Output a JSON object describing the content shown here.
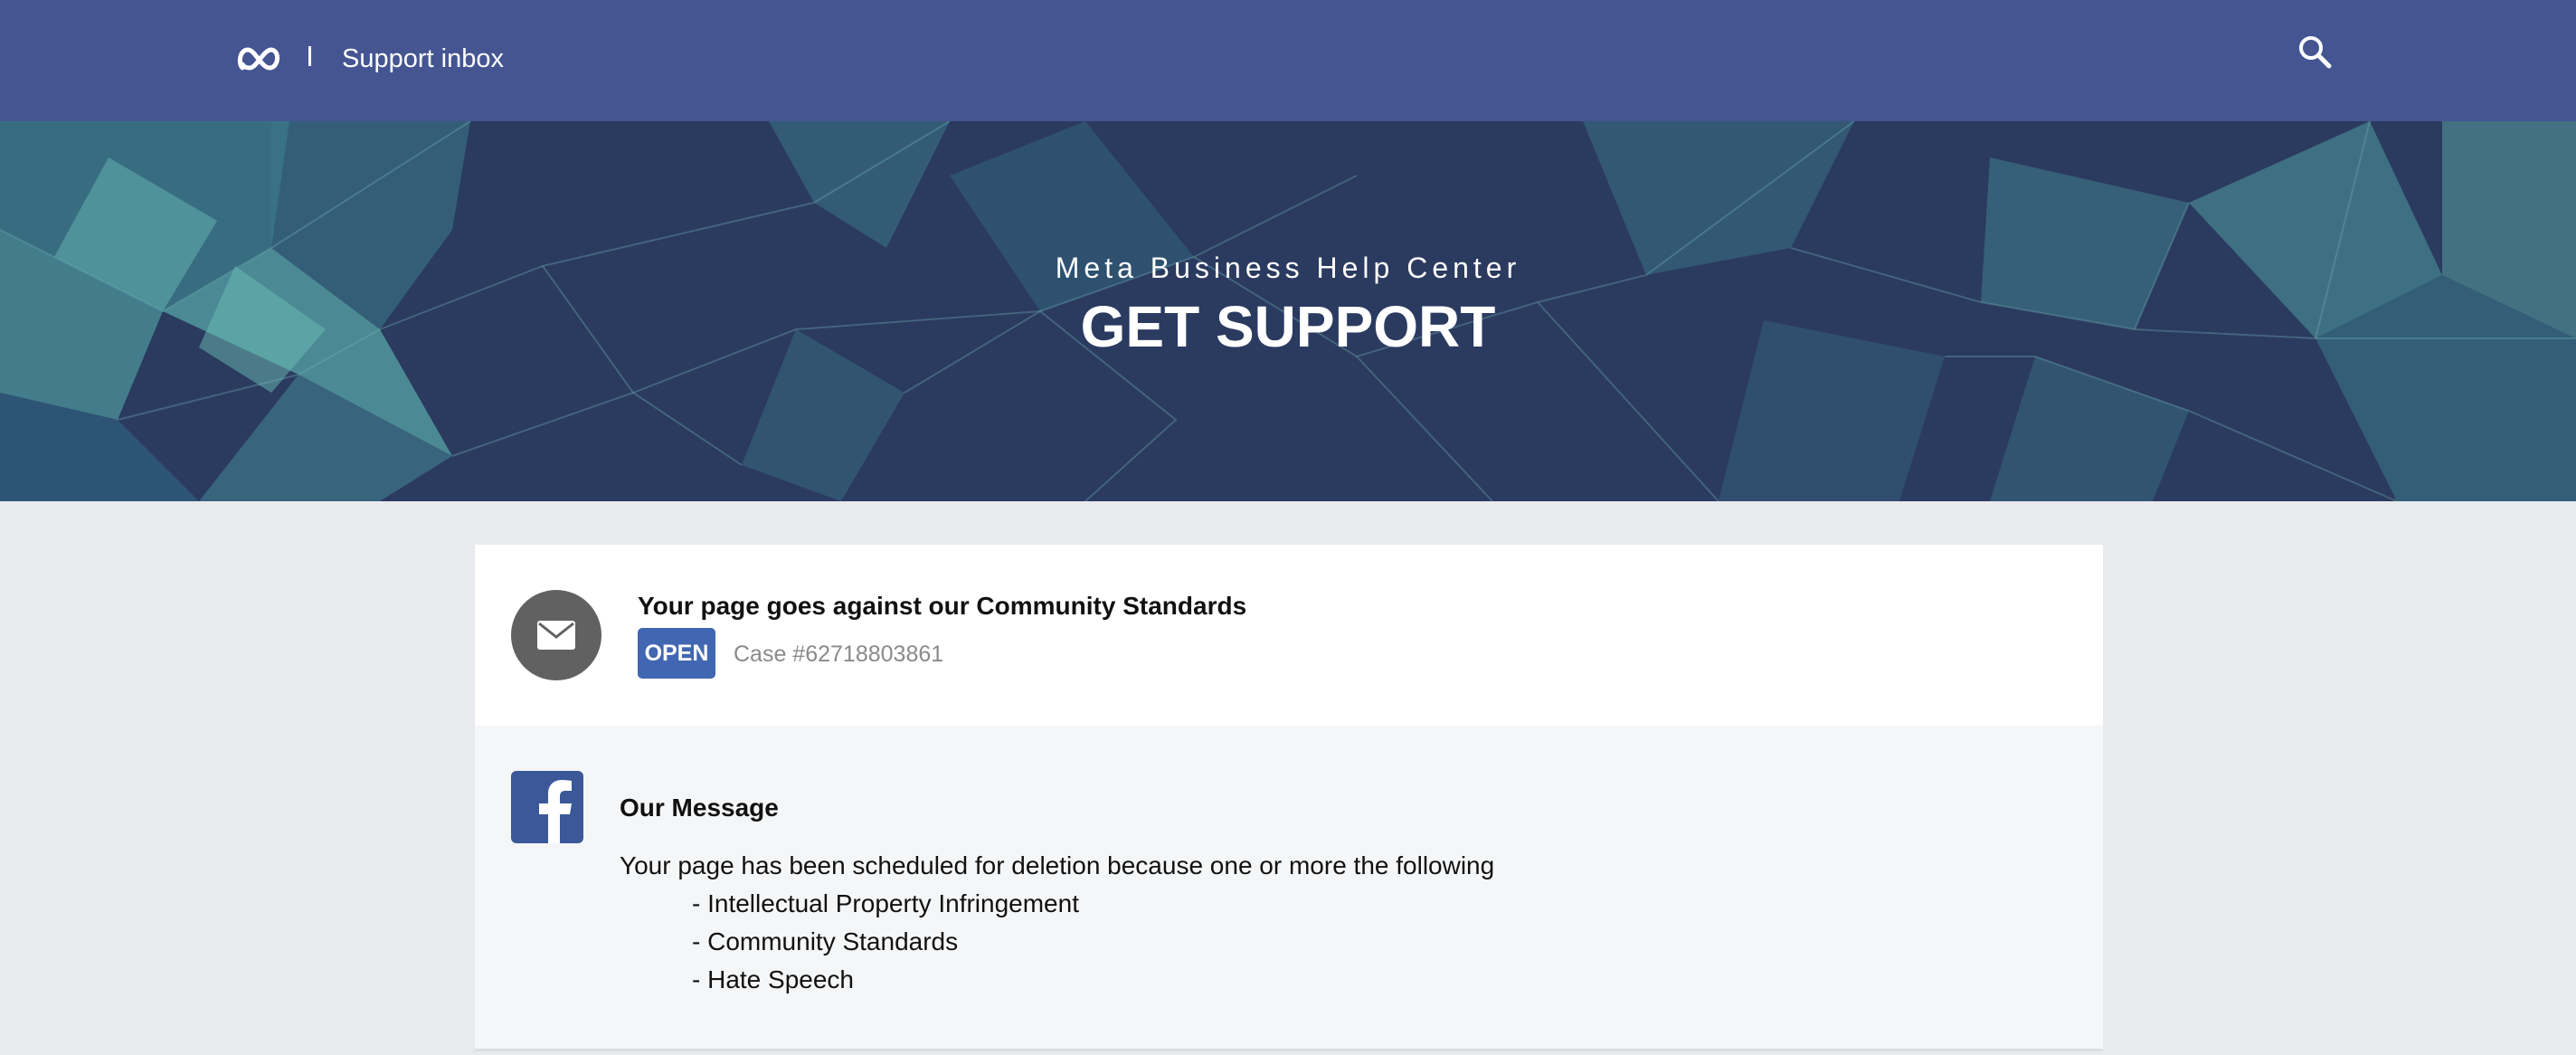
{
  "header": {
    "logo_icon": "meta-infinity-logo",
    "separator": "|",
    "title": "Support inbox",
    "search_icon": "search-icon"
  },
  "hero": {
    "subtitle": "Meta Business Help Center",
    "title": "GET SUPPORT"
  },
  "case": {
    "icon": "envelope-icon",
    "title": "Your page goes against our Community Standards",
    "status": "OPEN",
    "case_number": "Case #62718803861"
  },
  "message": {
    "icon": "facebook-icon",
    "heading": "Our Message",
    "body": "Your page has been scheduled for deletion because one or more the following",
    "items": [
      "- Intellectual Property Infringement",
      "- Community Standards",
      "- Hate Speech"
    ]
  },
  "colors": {
    "nav_bg": "#445592",
    "hero_bg": "#2b3a5f",
    "page_bg": "#e9eaee",
    "badge_blue": "#4267b2",
    "facebook_blue": "#3b5998"
  }
}
